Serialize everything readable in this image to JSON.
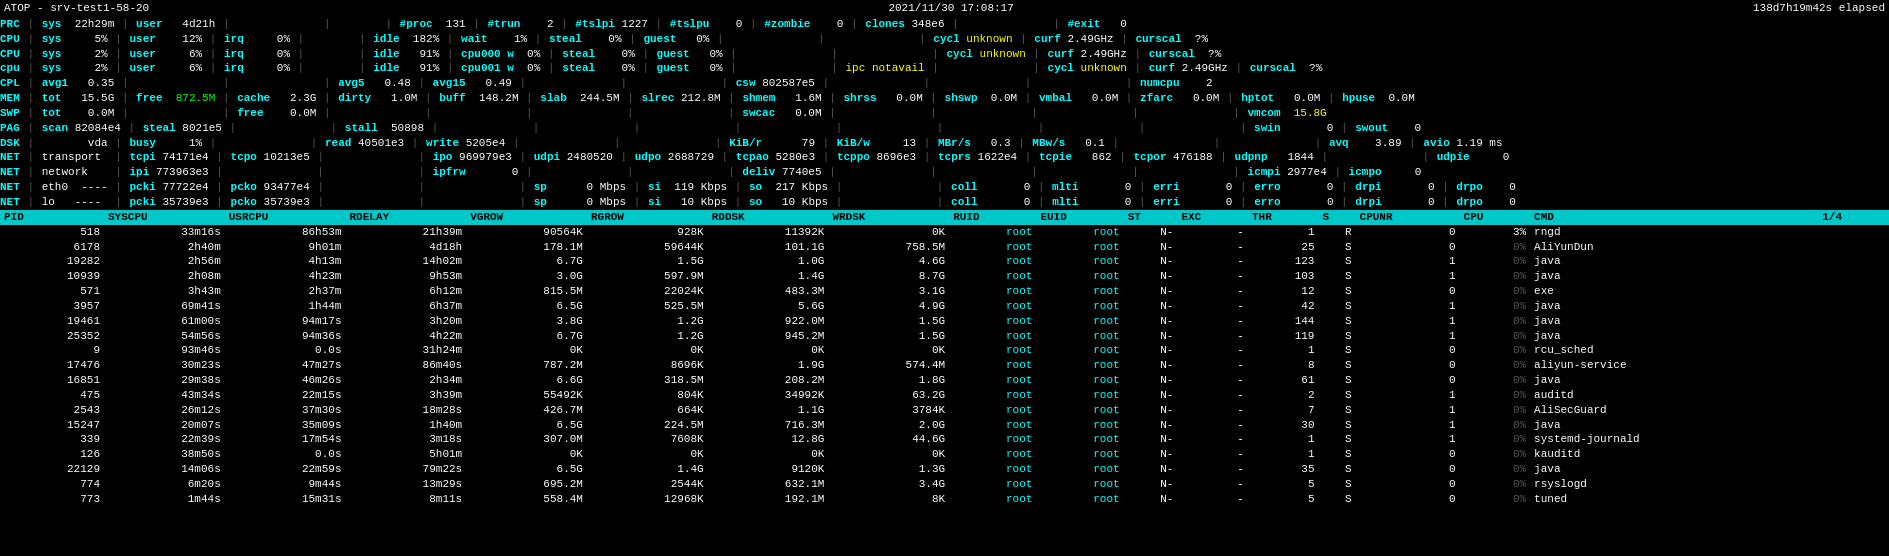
{
  "header": {
    "title": "ATOP - srv-test1-58-20",
    "datetime": "2021/11/30  17:08:17",
    "elapsed": "138d7h19m42s elapsed"
  },
  "top_display": "PRC | sys  22h29m | user   4d21h |              |        | #proc  131 | #trun    2 | #tslpi 1227 | #tslpu    0 | #zombie    0 | clones 348e6 |              | #exit   0\nCPU | sys     5% | user    12% | irq     0% |        | idle  182% | wait    1% | steal    0% | guest   0% |              |              | cycl unknown | curf 2.49GHz | curscal  ?%\nCPU | sys     2% | user     6% | irq     0% |        | idle   91% | cpu000 w  0% | steal    0% | guest   0% |              |              | cycl unknown | curf 2.49GHz | curscal  ?%\ncpu | sys     2% | user     6% | irq     0% |        | idle   91% | cpu001 w  0% | steal    0% | guest   0% |              | ipc notavail |              | cycl unknown | curf 2.49GHz | curscal  ?%\nCPL | avg1   0.35 |              |              | avg5   0.48 | avg15   0.49 |              |              | csw 802587e5 |              |              |              | numcpu    2\nMEM | tot   15.5G | free  872.5M | cache   2.3G | dirty   1.0M | buff  148.2M | slab  244.5M | slrec 212.8M | shmem   1.6M | shrss   0.0M | shswp  0.0M | vmbal   0.0M | zfarc   0.0M | hptot   0.0M | hpuse  0.0M\nSWP | tot    0.0M |              | free    0.0M |              |              |              |              | swcac   0.0M |              |              |              |              | vmcom  15.8G\nPAG | scan 82084e4 | steal 8021e5 |              | stall  50898 |              |              |              |              |              |              |              |              | swin       0 | swout    0\nDSK |        vda | busy     1% |              | read 40501e3 | write 5205e4 |              |              | KiB/r      79 | KiB/w     13 | MBr/s   0.3 | MBw/s   0.1 |              |              | avq    3.89 | avio 1.19 ms\nNET | transport  | tcpi 74171e4 | tcpo 10213e5 |              | ipo 969979e3 | udpi 2480520 | udpo 2688729 | tcpao 5280e3 | tcppo 8696e3 | tcprs 1622e4 | tcpie   862 | tcpor 476188 | udpnp   1844 |              | udpie     0\nNET | network    | ipi 773963e3 |              |              | ipfrw       0 |              |              | deliv 7740e5 |              |              |              |              | icmpi 2977e4 | icmpo     0\nNET | eth0  ---- | pcki 77722e4 | pcko 93477e4 |              |              | sp      0 Mbps | si  119 Kbps | so  217 Kbps |              | coll       0 | mlti       0 | erri       0 | erro       0 | drpi       0 | drpo    0\nNET | lo   ----  | pcki 35739e3 | pcko 35739e3 |              |              | sp      0 Mbps | si   10 Kbps | so   10 Kbps |              | coll       0 | mlti       0 | erri       0 | erro       0 | drpi       0 | drpo    0",
  "process_headers": [
    "PID",
    "SYSCPU",
    "USRCPU",
    "RDELAY",
    "VGROW",
    "RGROW",
    "RDDSK",
    "WRDSK",
    "RUID",
    "EUID",
    "ST",
    "EXC",
    "THR",
    "S",
    "CPUNR",
    "CPU",
    "CMD",
    "1/4"
  ],
  "processes": [
    [
      "518",
      "33m16s",
      "86h53m",
      "21h39m",
      "90564K",
      "928K",
      "11392K",
      "0K",
      "root",
      "root",
      "N-",
      "-",
      "1",
      "R",
      "0",
      "3%",
      "rngd"
    ],
    [
      "6178",
      "2h40m",
      "9h01m",
      "4d18h",
      "178.1M",
      "59644K",
      "101.1G",
      "758.5M",
      "root",
      "root",
      "N-",
      "-",
      "25",
      "S",
      "0",
      "0%",
      "AliYunDun"
    ],
    [
      "19282",
      "2h56m",
      "4h13m",
      "14h02m",
      "6.7G",
      "1.5G",
      "1.0G",
      "4.6G",
      "root",
      "root",
      "N-",
      "-",
      "123",
      "S",
      "1",
      "0%",
      "java"
    ],
    [
      "10939",
      "2h08m",
      "4h23m",
      "9h53m",
      "3.0G",
      "597.9M",
      "1.4G",
      "8.7G",
      "root",
      "root",
      "N-",
      "-",
      "103",
      "S",
      "1",
      "0%",
      "java"
    ],
    [
      "571",
      "3h43m",
      "2h37m",
      "6h12m",
      "815.5M",
      "22024K",
      "483.3M",
      "3.1G",
      "root",
      "root",
      "N-",
      "-",
      "12",
      "S",
      "0",
      "0%",
      "exe"
    ],
    [
      "3957",
      "69m41s",
      "1h44m",
      "6h37m",
      "6.5G",
      "525.5M",
      "5.6G",
      "4.9G",
      "root",
      "root",
      "N-",
      "-",
      "42",
      "S",
      "1",
      "0%",
      "java"
    ],
    [
      "19461",
      "61m00s",
      "94m17s",
      "3h20m",
      "3.8G",
      "1.2G",
      "922.0M",
      "1.5G",
      "root",
      "root",
      "N-",
      "-",
      "144",
      "S",
      "1",
      "0%",
      "java"
    ],
    [
      "25352",
      "54m56s",
      "94m36s",
      "4h22m",
      "6.7G",
      "1.2G",
      "945.2M",
      "1.5G",
      "root",
      "root",
      "N-",
      "-",
      "119",
      "S",
      "1",
      "0%",
      "java"
    ],
    [
      "9",
      "93m46s",
      "0.0s",
      "31h24m",
      "0K",
      "0K",
      "0K",
      "0K",
      "root",
      "root",
      "N-",
      "-",
      "1",
      "S",
      "0",
      "0%",
      "rcu_sched"
    ],
    [
      "17476",
      "30m23s",
      "47m27s",
      "86m40s",
      "787.2M",
      "8696K",
      "1.9G",
      "574.4M",
      "root",
      "root",
      "N-",
      "-",
      "8",
      "S",
      "0",
      "0%",
      "aliyun-service"
    ],
    [
      "16851",
      "29m38s",
      "46m26s",
      "2h34m",
      "6.6G",
      "318.5M",
      "208.2M",
      "1.8G",
      "root",
      "root",
      "N-",
      "-",
      "61",
      "S",
      "0",
      "0%",
      "java"
    ],
    [
      "475",
      "43m34s",
      "22m15s",
      "3h39m",
      "55492K",
      "804K",
      "34992K",
      "63.2G",
      "root",
      "root",
      "N-",
      "-",
      "2",
      "S",
      "1",
      "0%",
      "auditd"
    ],
    [
      "2543",
      "26m12s",
      "37m30s",
      "18m28s",
      "426.7M",
      "664K",
      "1.1G",
      "3784K",
      "root",
      "root",
      "N-",
      "-",
      "7",
      "S",
      "1",
      "0%",
      "AliSecGuard"
    ],
    [
      "15247",
      "20m07s",
      "35m09s",
      "1h40m",
      "6.5G",
      "224.5M",
      "716.3M",
      "2.0G",
      "root",
      "root",
      "N-",
      "-",
      "30",
      "S",
      "1",
      "0%",
      "java"
    ],
    [
      "339",
      "22m39s",
      "17m54s",
      "3m18s",
      "307.0M",
      "7608K",
      "12.8G",
      "44.6G",
      "root",
      "root",
      "N-",
      "-",
      "1",
      "S",
      "1",
      "0%",
      "systemd-journald"
    ],
    [
      "126",
      "38m50s",
      "0.0s",
      "5h01m",
      "0K",
      "0K",
      "0K",
      "0K",
      "root",
      "root",
      "N-",
      "-",
      "1",
      "S",
      "0",
      "0%",
      "kauditd"
    ],
    [
      "22129",
      "14m06s",
      "22m59s",
      "79m22s",
      "6.5G",
      "1.4G",
      "9120K",
      "1.3G",
      "root",
      "root",
      "N-",
      "-",
      "35",
      "S",
      "0",
      "0%",
      "java"
    ],
    [
      "774",
      "6m20s",
      "9m44s",
      "13m29s",
      "695.2M",
      "2544K",
      "632.1M",
      "3.4G",
      "root",
      "root",
      "N-",
      "-",
      "5",
      "S",
      "0",
      "0%",
      "rsyslogd"
    ],
    [
      "773",
      "1m44s",
      "15m31s",
      "8m11s",
      "558.4M",
      "12968K",
      "192.1M",
      "8K",
      "root",
      "root",
      "N-",
      "-",
      "5",
      "S",
      "0",
      "0%",
      "tuned"
    ]
  ]
}
